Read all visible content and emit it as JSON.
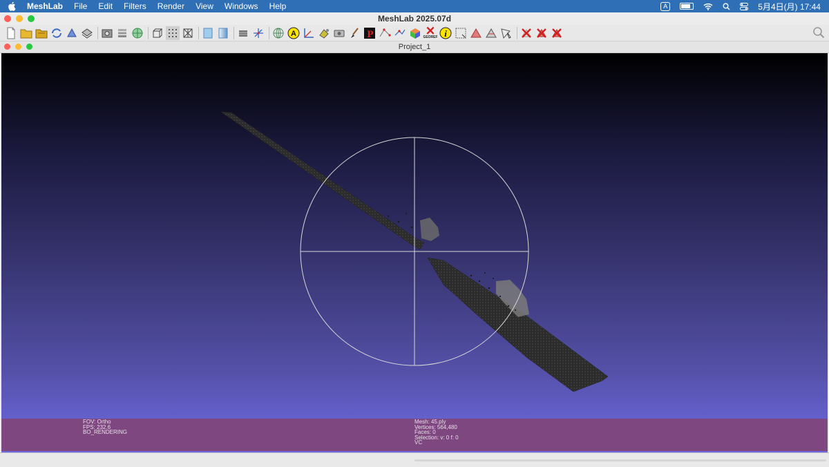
{
  "menubar": {
    "app_name": "MeshLab",
    "items": [
      "File",
      "Edit",
      "Filters",
      "Render",
      "View",
      "Windows",
      "Help"
    ],
    "input_indicator": "A",
    "clock": "5月4日(月)  17:44"
  },
  "window": {
    "title": "MeshLab 2025.07d"
  },
  "toolbar": {
    "icons": [
      "new-document-icon",
      "open-folder-icon",
      "open-project-icon",
      "reload-icon",
      "reload-all-icon",
      "save-icon",
      "snapshot-icon",
      "layers-icon",
      "globe-icon",
      "box-icon",
      "points-icon",
      "wireframe-icon",
      "flat-shading-icon",
      "smooth-shading-icon",
      "layer-stack-icon",
      "axes-icon",
      "sphere-grid-icon",
      "annotate-icon",
      "measure-icon",
      "paint-brush-icon",
      "camera-icon",
      "pencil-icon",
      "p-filter-icon",
      "point-pick-icon",
      "vertex-pick-icon",
      "color-cube-icon",
      "georef-icon",
      "info-icon",
      "select-faces-icon",
      "select-vertices-icon",
      "select-connected-icon",
      "select-area-icon",
      "delete-faces-icon",
      "delete-vertices-icon",
      "delete-all-icon"
    ],
    "georef_label": "GEOREF",
    "annotate_letter": "A",
    "info_letter": "i",
    "p_letter": "P"
  },
  "subwindow": {
    "title": "Project_1"
  },
  "viewport": {
    "left_info": [
      "FOV: Ortho",
      "FPS:    232.6",
      "BO_RENDERING"
    ],
    "mesh_info": [
      "Mesh: 45.ply",
      "Vertices: 564,480",
      "Faces: 0",
      "Selection: v: 0 f: 0",
      "VC"
    ],
    "colors": {
      "bg_top": "#000000",
      "bg_bottom": "#6f6be6",
      "infobar": "#7e4780",
      "trackball": "#d8d8d8"
    }
  }
}
